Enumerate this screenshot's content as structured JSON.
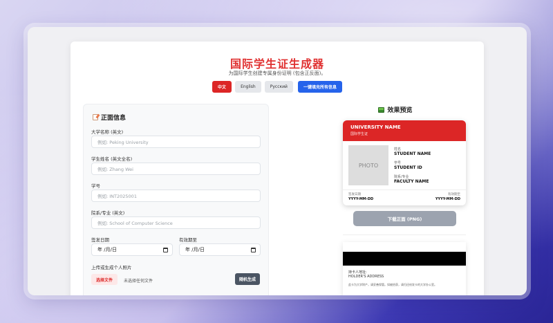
{
  "header": {
    "title": "国际学生证生成器",
    "subtitle": "为国际学生创建专属身份证明 (包含正反面)。"
  },
  "languages": [
    {
      "label": "中文",
      "active": true
    },
    {
      "label": "English",
      "active": false
    },
    {
      "label": "Русский",
      "active": false
    }
  ],
  "fill_all_label": "一键填充所有信息",
  "form": {
    "section_title": "正面信息",
    "university": {
      "label": "大学名称 (英文)",
      "placeholder": "例如: Peking University"
    },
    "student_name": {
      "label": "学生姓名 (英文全名)",
      "placeholder": "例如: Zhang Wei"
    },
    "student_id": {
      "label": "学号",
      "placeholder": "例如: INT2025001"
    },
    "faculty": {
      "label": "院系/专业 (英文)",
      "placeholder": "例如: School of Computer Science"
    },
    "issue_date": {
      "label": "签发日期",
      "value": "年 /月/日"
    },
    "expiry_date": {
      "label": "有效期至",
      "value": "年 /月/日"
    },
    "photo": {
      "label": "上传或生成个人照片",
      "choose_file": "选择文件",
      "no_file": "未选择任何文件",
      "random": "随机生成"
    }
  },
  "preview": {
    "title": "效果预览",
    "card": {
      "university": "UNIVERSITY NAME",
      "university_sub": "国际学生证",
      "photo": "PHOTO",
      "name_label": "姓名",
      "name_value": "STUDENT NAME",
      "id_label": "学号",
      "id_value": "STUDENT ID",
      "faculty_label": "院系/专业",
      "faculty_value": "FACULTY NAME",
      "issue_label": "签发日期",
      "issue_value": "YYYY-MM-DD",
      "expiry_label": "有效期至",
      "expiry_value": "YYYY-MM-DD"
    },
    "download_label": "下载正面 (PNG)",
    "back": {
      "addr_label": "持卡人地址:",
      "addr_label_en": "HOLDER'S ADDRESS",
      "note": "此卡为大学财产，请妥善保管。如被拾获，请归还给发卡的大学办公室。"
    }
  }
}
